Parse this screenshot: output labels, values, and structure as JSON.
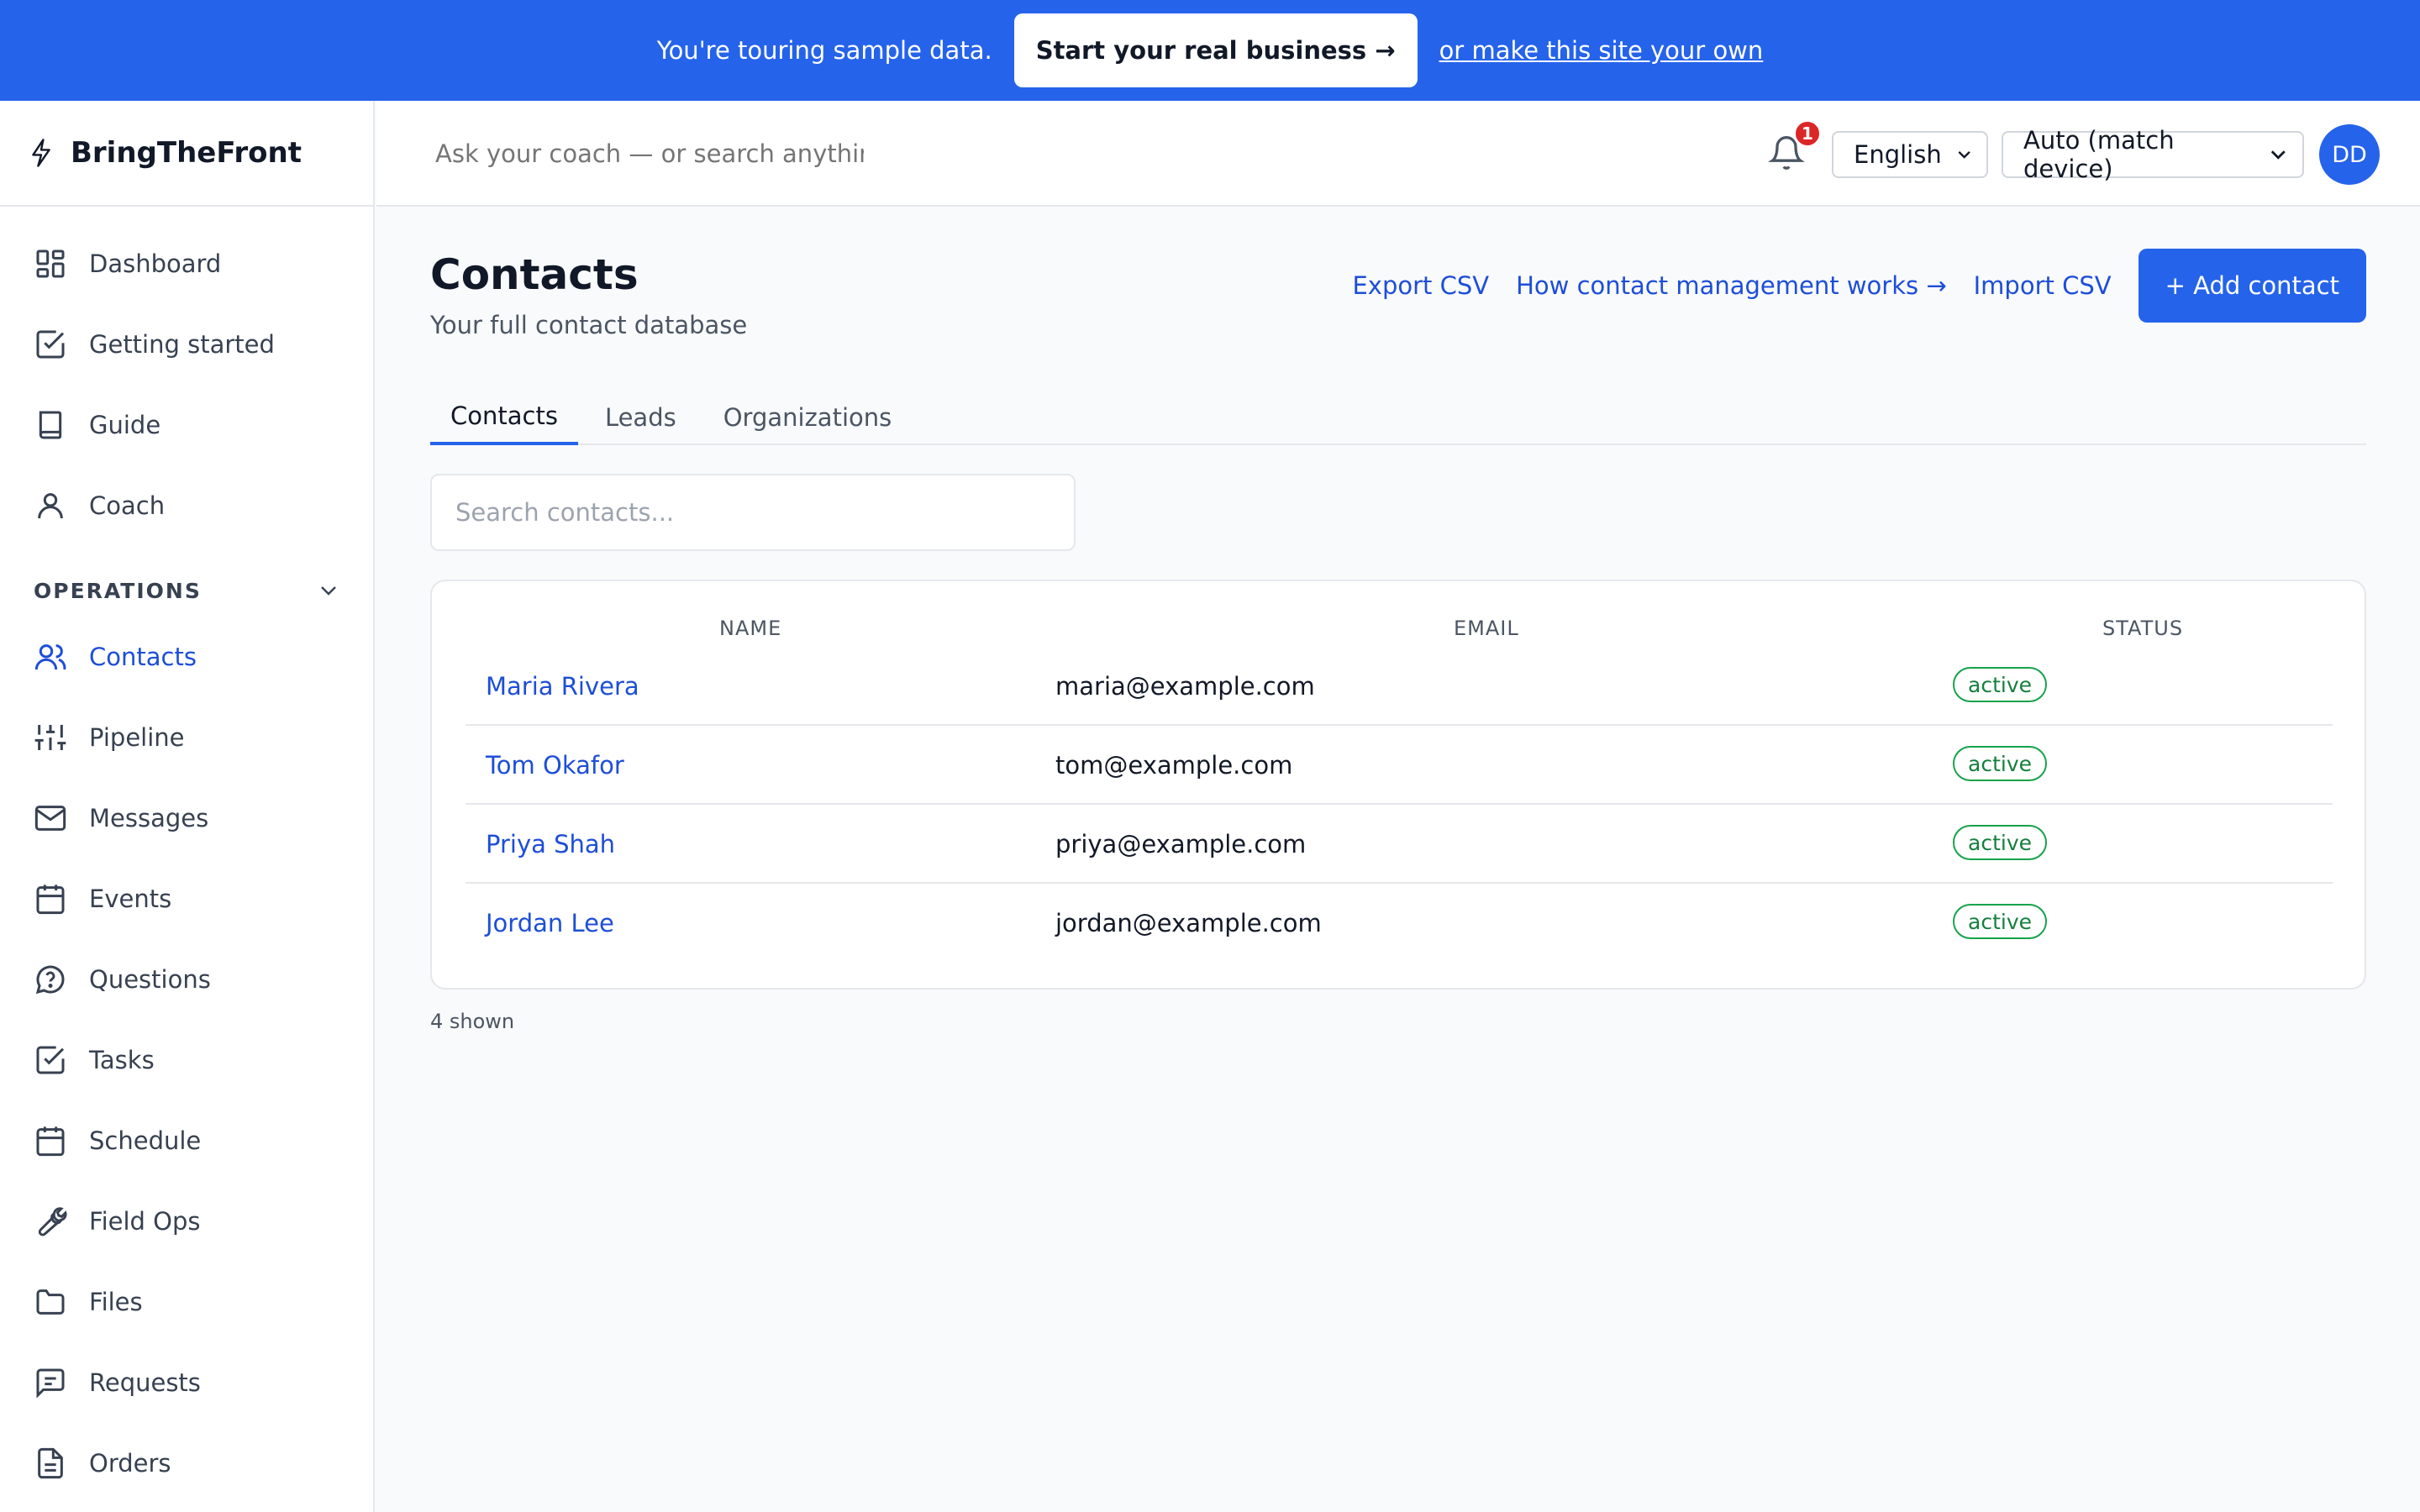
{
  "banner": {
    "text": "You're touring sample data.",
    "cta": "Start your real business →",
    "link": "or make this site your own"
  },
  "brand": {
    "name": "BringTheFront",
    "icon": "bolt-icon"
  },
  "topbar": {
    "search_placeholder": "Ask your coach — or search anythir",
    "notification_count": "1",
    "language": "English",
    "theme": "Auto (match device)",
    "avatar_initials": "DD"
  },
  "sidebar": {
    "items": [
      {
        "label": "Dashboard",
        "icon": "dashboard-icon"
      },
      {
        "label": "Getting started",
        "icon": "check-square-icon"
      },
      {
        "label": "Guide",
        "icon": "book-icon"
      },
      {
        "label": "Coach",
        "icon": "user-icon"
      }
    ],
    "section_label": "OPERATIONS",
    "ops_items": [
      {
        "label": "Contacts",
        "icon": "users-icon",
        "active": true
      },
      {
        "label": "Pipeline",
        "icon": "sliders-icon"
      },
      {
        "label": "Messages",
        "icon": "mail-icon"
      },
      {
        "label": "Events",
        "icon": "calendar-icon"
      },
      {
        "label": "Questions",
        "icon": "question-bubble-icon"
      },
      {
        "label": "Tasks",
        "icon": "check-square-icon"
      },
      {
        "label": "Schedule",
        "icon": "calendar-icon"
      },
      {
        "label": "Field Ops",
        "icon": "wrench-icon"
      },
      {
        "label": "Files",
        "icon": "folder-icon"
      },
      {
        "label": "Requests",
        "icon": "message-square-icon"
      },
      {
        "label": "Orders",
        "icon": "file-text-icon"
      }
    ]
  },
  "page": {
    "title": "Contacts",
    "subtitle": "Your full contact database",
    "actions": {
      "export": "Export CSV",
      "howto": "How contact management works →",
      "import": "Import CSV",
      "add": "+ Add contact"
    },
    "tabs": [
      "Contacts",
      "Leads",
      "Organizations"
    ],
    "search_placeholder": "Search contacts...",
    "table": {
      "headers": [
        "NAME",
        "EMAIL",
        "STATUS"
      ],
      "rows": [
        {
          "name": "Maria Rivera",
          "email": "maria@example.com",
          "status": "active"
        },
        {
          "name": "Tom Okafor",
          "email": "tom@example.com",
          "status": "active"
        },
        {
          "name": "Priya Shah",
          "email": "priya@example.com",
          "status": "active"
        },
        {
          "name": "Jordan Lee",
          "email": "jordan@example.com",
          "status": "active"
        }
      ]
    },
    "count_text": "4 shown"
  },
  "colors": {
    "accent": "#2563eb",
    "link": "#1d4ed8",
    "status_active": "#16a34a",
    "notification": "#dc2626"
  }
}
